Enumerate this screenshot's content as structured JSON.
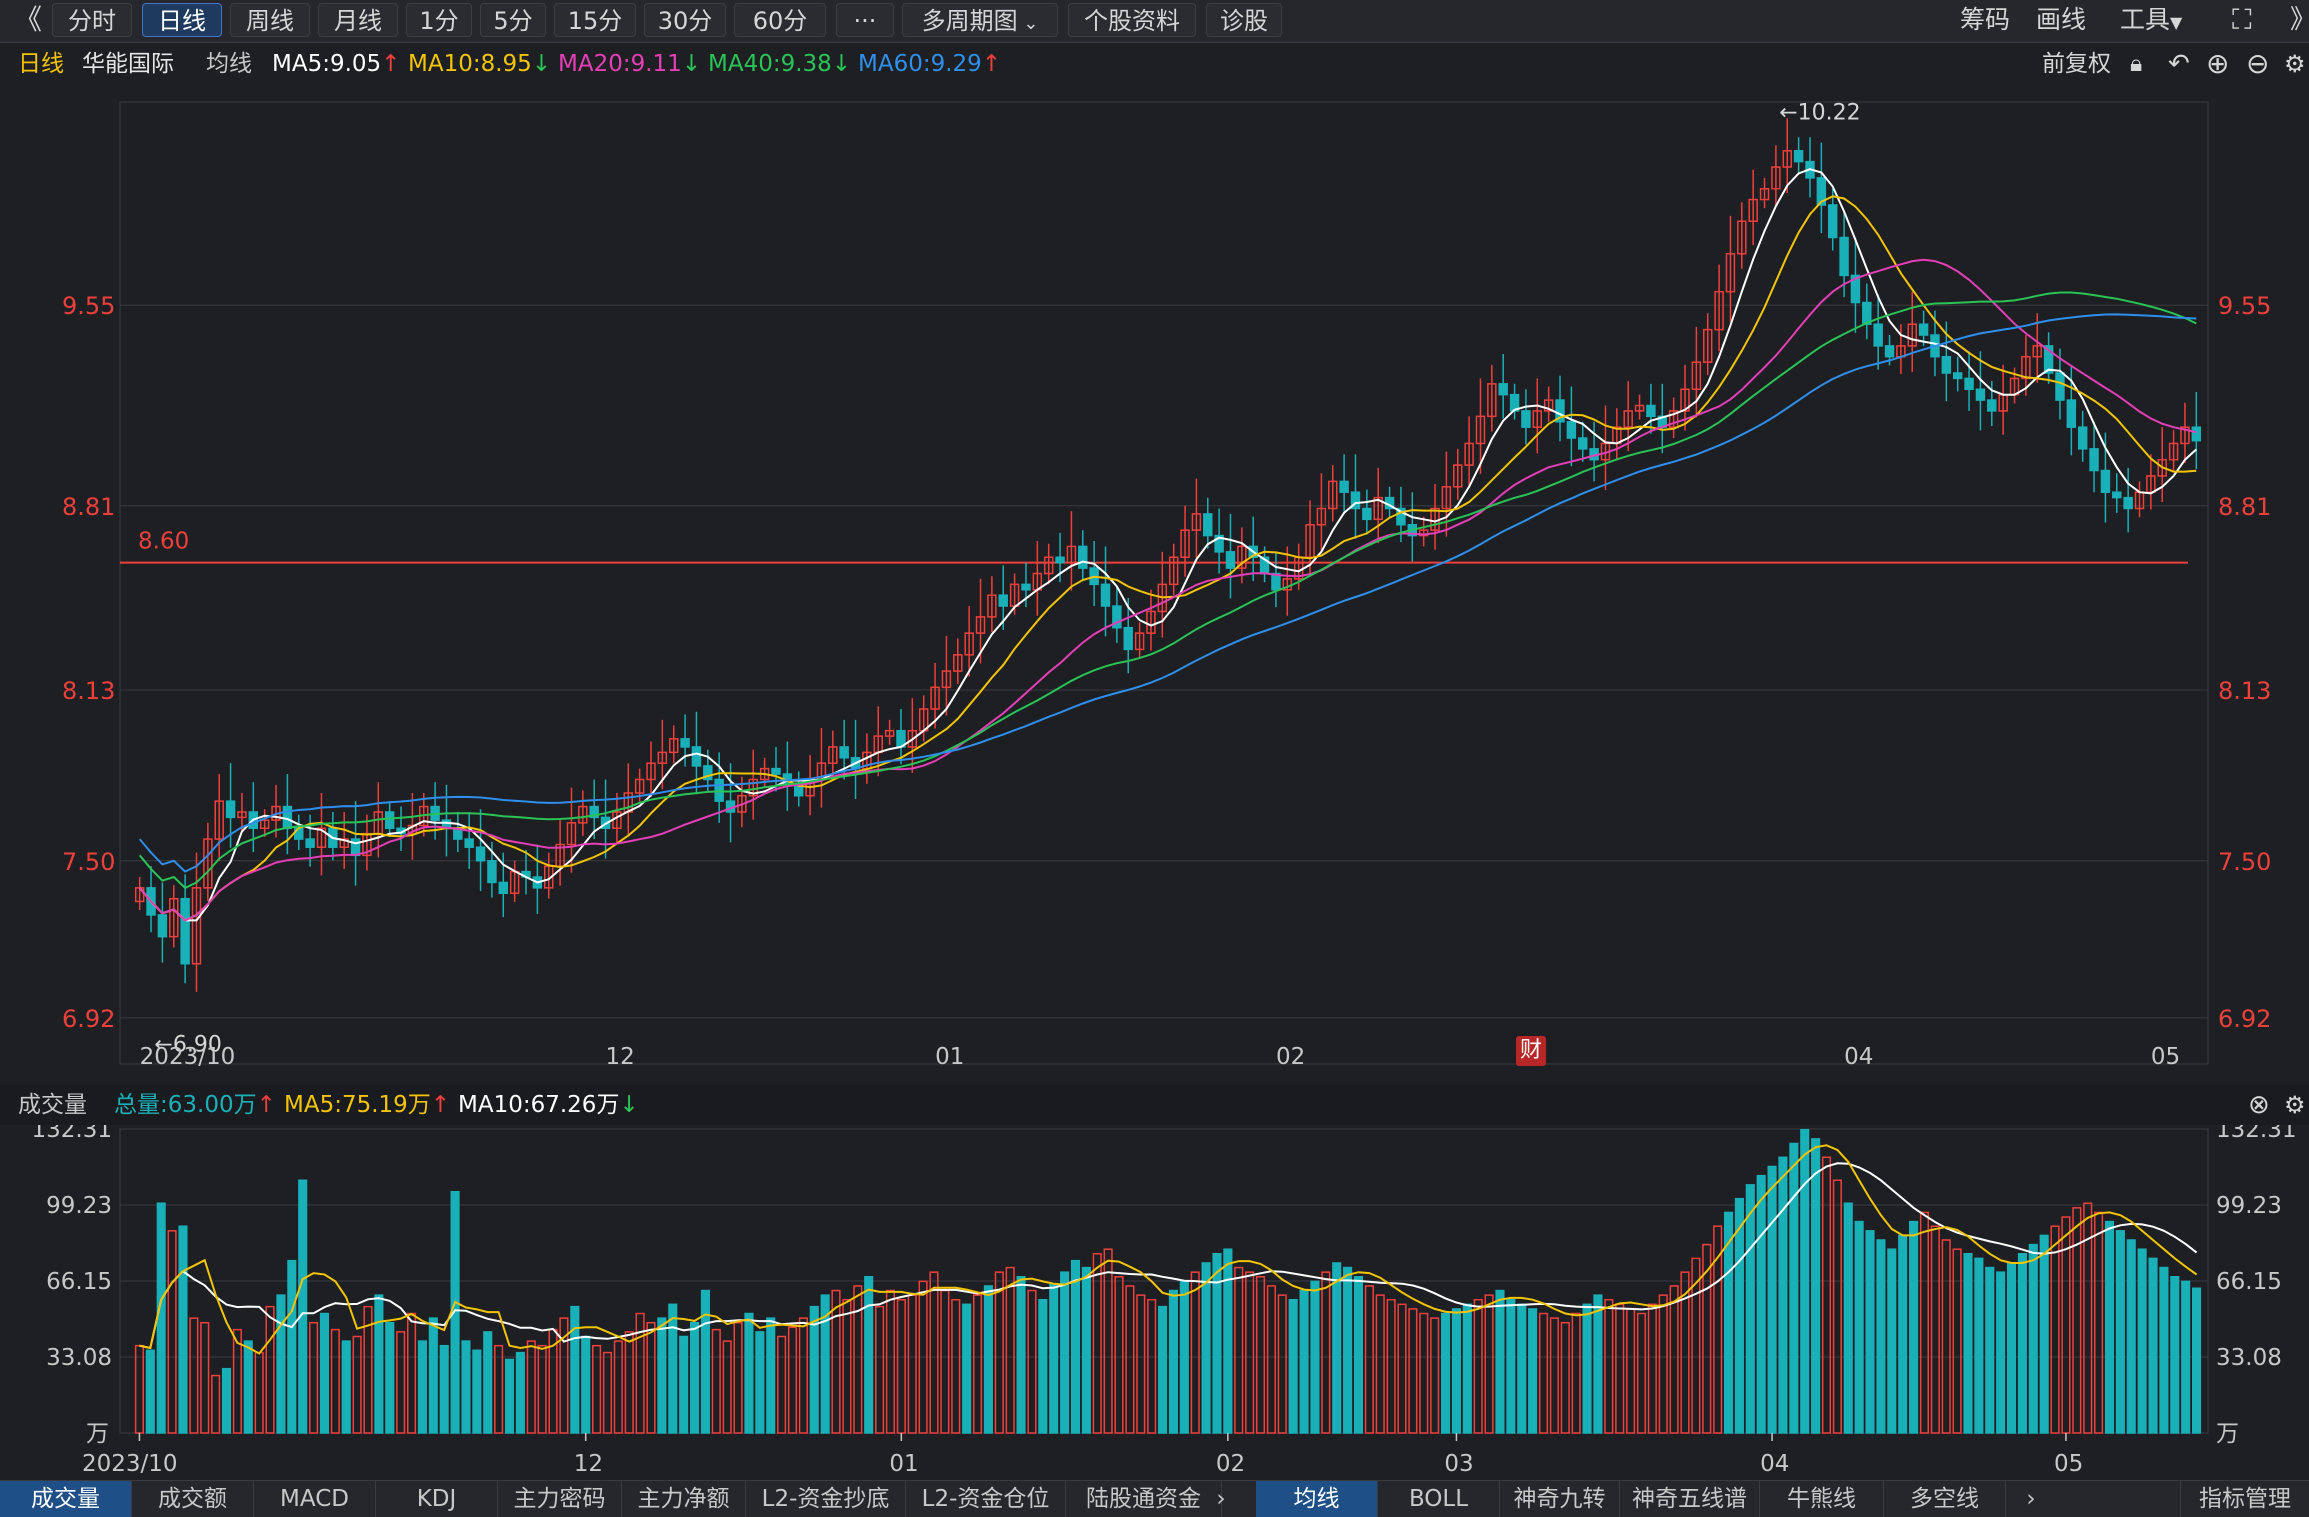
{
  "toolbar": {
    "back_glyph": "《",
    "periods": [
      "分时",
      "日线",
      "周线",
      "月线",
      "1分",
      "5分",
      "15分",
      "30分",
      "60分"
    ],
    "active_period": "日线",
    "more": "···",
    "multi_period": "多周期图",
    "stock_info": "个股资料",
    "diagnose": "诊股",
    "chips": "筹码",
    "draw": "画线",
    "tools": "工具"
  },
  "info": {
    "period": "日线",
    "stock_name": "华能国际",
    "ma_label": "均线",
    "ma5": "MA5:9.05",
    "ma10": "MA10:8.95",
    "ma20": "MA20:9.11",
    "ma40": "MA40:9.38",
    "ma60": "MA60:9.29",
    "adjust": "前复权",
    "up_arrow": "↑",
    "down_arrow": "↓"
  },
  "colors": {
    "up": "#f0403c",
    "down": "#19b0b8",
    "ma5": "#ffffff",
    "ma10": "#f5c400",
    "ma20": "#e43fb6",
    "ma40": "#2ac356",
    "ma60": "#2f8fee",
    "grid": "#3a3b40",
    "axis_text": "#f0403c"
  },
  "chart_data": {
    "type": "candlestick",
    "price_axis_ticks": [
      6.92,
      7.5,
      8.13,
      8.81,
      9.55
    ],
    "price_axis_labels": [
      "6.92",
      "7.50",
      "8.13",
      "8.81",
      "9.55"
    ],
    "ylim": [
      6.75,
      10.3
    ],
    "horizontal_line": {
      "value": 8.6,
      "label": "8.60"
    },
    "annotations": [
      {
        "label": "←10.22",
        "value": 10.22
      },
      {
        "label": "←6.90",
        "value": 6.9
      }
    ],
    "x_labels": [
      {
        "label": "2023/10",
        "index": 0
      },
      {
        "label": "12",
        "index": 41
      },
      {
        "label": "01",
        "index": 70
      },
      {
        "label": "02",
        "index": 100
      },
      {
        "label": "03",
        "index": 121
      },
      {
        "label": "04",
        "index": 150
      },
      {
        "label": "05",
        "index": 177
      }
    ],
    "closes": [
      7.4,
      7.3,
      7.22,
      7.36,
      7.12,
      7.4,
      7.58,
      7.72,
      7.66,
      7.68,
      7.62,
      7.65,
      7.7,
      7.62,
      7.58,
      7.55,
      7.62,
      7.55,
      7.58,
      7.52,
      7.6,
      7.68,
      7.62,
      7.6,
      7.63,
      7.7,
      7.65,
      7.62,
      7.58,
      7.55,
      7.5,
      7.42,
      7.38,
      7.46,
      7.44,
      7.4,
      7.48,
      7.56,
      7.64,
      7.7,
      7.66,
      7.62,
      7.68,
      7.75,
      7.8,
      7.86,
      7.9,
      7.95,
      7.92,
      7.85,
      7.8,
      7.72,
      7.68,
      7.74,
      7.8,
      7.84,
      7.82,
      7.78,
      7.74,
      7.8,
      7.86,
      7.92,
      7.88,
      7.84,
      7.9,
      7.96,
      7.98,
      7.92,
      7.98,
      8.06,
      8.14,
      8.2,
      8.26,
      8.34,
      8.4,
      8.48,
      8.44,
      8.52,
      8.5,
      8.56,
      8.62,
      8.6,
      8.66,
      8.58,
      8.52,
      8.44,
      8.36,
      8.28,
      8.34,
      8.42,
      8.52,
      8.62,
      8.72,
      8.78,
      8.7,
      8.64,
      8.58,
      8.66,
      8.62,
      8.56,
      8.5,
      8.54,
      8.62,
      8.74,
      8.8,
      8.9,
      8.86,
      8.8,
      8.76,
      8.84,
      8.8,
      8.74,
      8.7,
      8.72,
      8.8,
      8.88,
      8.96,
      9.04,
      9.14,
      9.26,
      9.22,
      9.16,
      9.1,
      9.16,
      9.2,
      9.12,
      9.06,
      9.02,
      8.98,
      9.04,
      9.1,
      9.16,
      9.18,
      9.14,
      9.1,
      9.16,
      9.24,
      9.34,
      9.46,
      9.6,
      9.74,
      9.86,
      9.94,
      9.98,
      10.06,
      10.12,
      10.08,
      10.02,
      9.92,
      9.8,
      9.66,
      9.56,
      9.48,
      9.4,
      9.36,
      9.4,
      9.48,
      9.44,
      9.36,
      9.3,
      9.28,
      9.24,
      9.2,
      9.16,
      9.22,
      9.28,
      9.36,
      9.4,
      9.3,
      9.2,
      9.1,
      9.02,
      8.94,
      8.86,
      8.84,
      8.8,
      8.86,
      8.92,
      8.98,
      9.04,
      9.1,
      9.05
    ],
    "volumes": [
      38,
      36,
      100,
      88,
      90,
      50,
      48,
      25,
      28,
      45,
      40,
      35,
      55,
      60,
      75,
      110,
      48,
      52,
      45,
      40,
      42,
      55,
      60,
      48,
      44,
      52,
      40,
      50,
      38,
      105,
      40,
      36,
      44,
      38,
      32,
      35,
      40,
      38,
      45,
      50,
      55,
      42,
      38,
      35,
      40,
      44,
      52,
      48,
      50,
      56,
      42,
      48,
      62,
      45,
      40,
      48,
      52,
      44,
      50,
      42,
      46,
      50,
      55,
      60,
      62,
      58,
      64,
      68,
      55,
      62,
      58,
      60,
      66,
      70,
      62,
      58,
      56,
      60,
      64,
      70,
      72,
      68,
      62,
      58,
      65,
      70,
      75,
      72,
      78,
      80,
      68,
      64,
      60,
      58,
      55,
      62,
      66,
      70,
      74,
      78,
      80,
      72,
      70,
      68,
      64,
      60,
      58,
      62,
      66,
      70,
      74,
      72,
      68,
      64,
      60,
      58,
      56,
      54,
      52,
      50,
      52,
      54,
      56,
      58,
      60,
      62,
      58,
      56,
      54,
      52,
      50,
      48,
      52,
      56,
      60,
      58,
      56,
      54,
      52,
      56,
      60,
      64,
      70,
      76,
      82,
      90,
      96,
      102,
      108,
      112,
      116,
      120,
      126,
      132,
      128,
      120,
      110,
      100,
      92,
      88,
      84,
      80,
      86,
      92,
      96,
      90,
      84,
      80,
      78,
      76,
      72,
      70,
      74,
      78,
      82,
      86,
      90,
      94,
      98,
      100,
      96,
      92,
      88,
      84,
      80,
      76,
      72,
      68,
      66,
      63
    ],
    "volume_axis_ticks": [
      33.08,
      66.15,
      99.23,
      132.31
    ],
    "volume_axis_labels": [
      "33.08",
      "66.15",
      "99.23",
      "132.31"
    ],
    "volume_unit": "万",
    "volume_ylim": [
      0,
      132.31
    ]
  },
  "volume_info": {
    "label": "成交量",
    "total": "总量:63.00万",
    "ma5": "MA5:75.19万",
    "ma10": "MA10:67.26万",
    "up_arrow": "↑",
    "down_arrow": "↓"
  },
  "cai_tag": "财",
  "bottom_tabs": [
    "成交量",
    "成交额",
    "MACD",
    "KDJ",
    "主力密码",
    "主力净额",
    "L2-资金抄底",
    "L2-资金仓位",
    "陆股通资金"
  ],
  "bottom_tabs2": [
    "均线",
    "BOLL",
    "神奇九转",
    "神奇五线谱",
    "牛熊线",
    "多空线"
  ],
  "indicator_manage": "指标管理"
}
